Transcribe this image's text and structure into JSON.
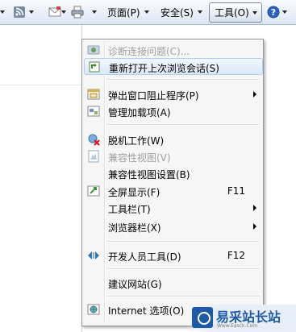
{
  "toolbar": {
    "page_label": "页面(P)",
    "safety_label": "安全(S)",
    "tools_label": "工具(O)",
    "icons": [
      "rss-feed-icon",
      "read-mail-icon",
      "print-icon",
      "help-icon"
    ]
  },
  "menu": {
    "items": [
      {
        "label": "诊断连接问题(C)...",
        "shortcut": "",
        "disabled": true,
        "submenu": false,
        "icon": "diagnose-connection-icon"
      },
      {
        "label": "重新打开上次浏览会话(S)",
        "shortcut": "",
        "disabled": false,
        "submenu": false,
        "icon": "reopen-session-icon"
      },
      {
        "label": "弹出窗口阻止程序(P)",
        "shortcut": "",
        "disabled": false,
        "submenu": true,
        "icon": "popup-blocker-icon"
      },
      {
        "label": "管理加载项(A)",
        "shortcut": "",
        "disabled": false,
        "submenu": false,
        "icon": "addons-icon"
      },
      {
        "label": "脱机工作(W)",
        "shortcut": "",
        "disabled": false,
        "submenu": false,
        "icon": "work-offline-icon"
      },
      {
        "label": "兼容性视图(V)",
        "shortcut": "",
        "disabled": true,
        "submenu": false,
        "icon": "compatibility-view-icon"
      },
      {
        "label": "兼容性视图设置(B)",
        "shortcut": "",
        "disabled": false,
        "submenu": false,
        "icon": ""
      },
      {
        "label": "全屏显示(F)",
        "shortcut": "F11",
        "disabled": false,
        "submenu": false,
        "icon": "fullscreen-icon"
      },
      {
        "label": "工具栏(T)",
        "shortcut": "",
        "disabled": false,
        "submenu": true,
        "icon": ""
      },
      {
        "label": "浏览器栏(X)",
        "shortcut": "",
        "disabled": false,
        "submenu": true,
        "icon": ""
      },
      {
        "label": "开发人员工具(D)",
        "shortcut": "F12",
        "disabled": false,
        "submenu": false,
        "icon": "developer-tools-icon"
      },
      {
        "label": "建议网站(G)",
        "shortcut": "",
        "disabled": false,
        "submenu": false,
        "icon": ""
      },
      {
        "label": "Internet 选项(O)",
        "shortcut": "",
        "disabled": false,
        "submenu": false,
        "icon": "internet-options-icon"
      }
    ]
  },
  "watermark": {
    "title": "易采站长站",
    "subtitle": "Www.Easck.Com"
  },
  "colors": {
    "accent": "#1e5aa8",
    "menu_bg": "#f6f6f6",
    "disabled_text": "#a0a0a0"
  }
}
